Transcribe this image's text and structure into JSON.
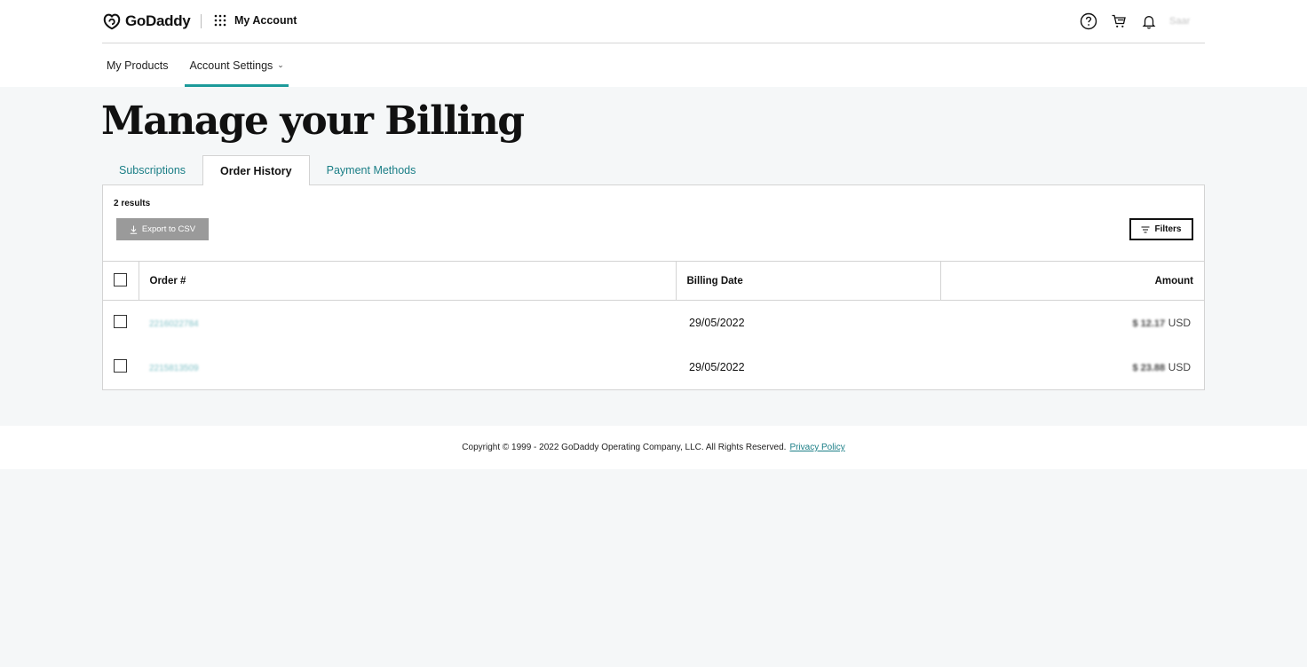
{
  "header": {
    "brand": "GoDaddy",
    "app_label": "My Account",
    "user_name": "Saar",
    "icons": [
      "help-icon",
      "cart-icon",
      "bell-icon"
    ]
  },
  "subnav": {
    "items": [
      {
        "label": "My Products"
      },
      {
        "label": "Account Settings"
      }
    ]
  },
  "page": {
    "title": "Manage your Billing"
  },
  "tabs": [
    {
      "label": "Subscriptions"
    },
    {
      "label": "Order History"
    },
    {
      "label": "Payment Methods"
    }
  ],
  "orders": {
    "results_text": "2 results",
    "export_label": "Export to CSV",
    "filters_label": "Filters",
    "columns": {
      "order": "Order #",
      "billing_date": "Billing Date",
      "amount": "Amount"
    },
    "rows": [
      {
        "order_no": "2216022784",
        "date": "29/05/2022",
        "amount": "$ 12.17",
        "currency": "USD"
      },
      {
        "order_no": "2215813509",
        "date": "29/05/2022",
        "amount": "$ 23.88",
        "currency": "USD"
      }
    ]
  },
  "footer": {
    "copyright": "Copyright © 1999 - 2022 GoDaddy Operating Company, LLC. All Rights Reserved.",
    "privacy_link": "Privacy Policy"
  },
  "colors": {
    "accent": "#1c9a9a",
    "link": "#1a7e86",
    "page_bg": "#f5f7f8"
  }
}
